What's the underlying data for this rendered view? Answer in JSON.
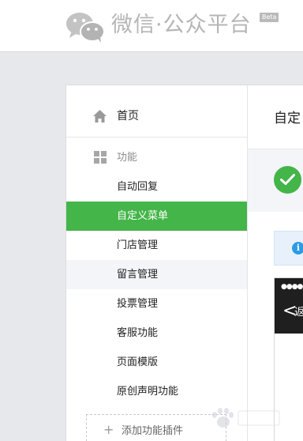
{
  "header": {
    "logo_icon": "wechat-logo-icon",
    "title": "微信·公众平台",
    "badge": "Beta"
  },
  "sidebar": {
    "home": {
      "icon": "home-icon",
      "label": "首页"
    },
    "section": {
      "icon": "grid-icon",
      "label": "功能"
    },
    "items": [
      {
        "label": "自动回复",
        "state": "normal"
      },
      {
        "label": "自定义菜单",
        "state": "active"
      },
      {
        "label": "门店管理",
        "state": "normal"
      },
      {
        "label": "留言管理",
        "state": "hover"
      },
      {
        "label": "投票管理",
        "state": "normal"
      },
      {
        "label": "客服功能",
        "state": "normal"
      },
      {
        "label": "页面模版",
        "state": "normal"
      },
      {
        "label": "原创声明功能",
        "state": "normal"
      }
    ],
    "add_plugin": {
      "icon": "plus-icon",
      "label": "添加功能插件"
    }
  },
  "main": {
    "title": "自定",
    "success_icon": "check-icon",
    "info_icon": "info-icon",
    "info_glyph": "i",
    "phone_status": "●●●●",
    "phone_back": "<",
    "phone_back_text": "返"
  },
  "watermark": {
    "note": "Baidu watermark (partially visible)"
  },
  "colors": {
    "accent_green": "#44b549",
    "info_blue": "#2c9be3",
    "page_bg": "#e7e8eb",
    "logo_gray": "#b5b5b5"
  }
}
